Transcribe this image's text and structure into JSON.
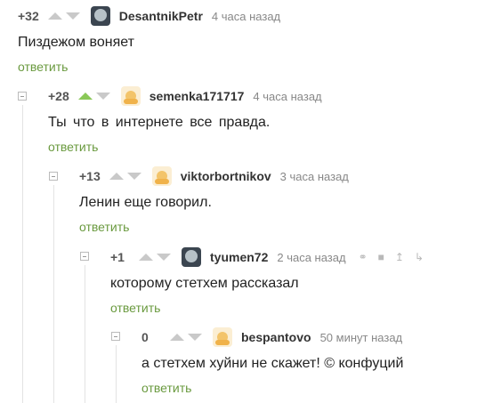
{
  "comments": [
    {
      "rating": "+32",
      "user": "DesantnikPetr",
      "time": "4 часа назад",
      "text": "Пиздежом воняет",
      "reply": "ответить"
    },
    {
      "rating": "+28",
      "user": "semenka171717",
      "time": "4 часа назад",
      "text": "Ты что в интернете все правда.",
      "reply": "ответить"
    },
    {
      "rating": "+13",
      "user": "viktorbortnikov",
      "time": "3 часа назад",
      "text": "Ленин еще говорил.",
      "reply": "ответить"
    },
    {
      "rating": "+1",
      "user": "tyumen72",
      "time": "2 часа назад",
      "text": "которому стетхем рассказал",
      "reply": "ответить"
    },
    {
      "rating": "0",
      "user": "bespantovo",
      "time": "50 минут назад",
      "text": "а стетхем хуйни не скажет! © конфуций",
      "reply": "ответить"
    }
  ],
  "icons": {
    "upvote": "arrow-up-icon",
    "downvote": "arrow-down-icon",
    "collapse": "collapse-icon",
    "link": "link-icon",
    "save": "save-icon",
    "up-thread": "thread-up-icon",
    "more": "more-icon"
  },
  "colors": {
    "reply_link": "#6a9a3f",
    "upvote_active": "#8ac858"
  }
}
